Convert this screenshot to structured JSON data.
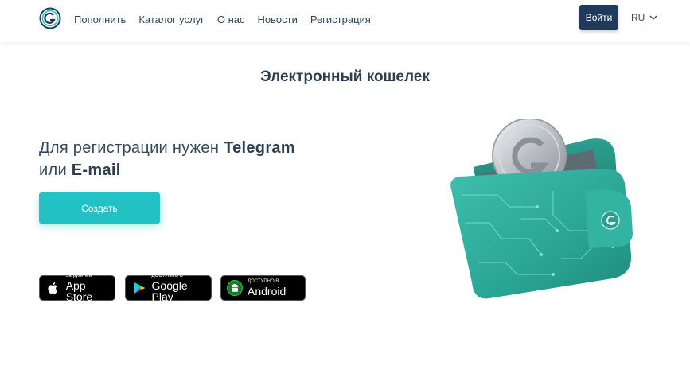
{
  "header": {
    "nav": [
      "Пополнить",
      "Каталог услуг",
      "О нас",
      "Новости",
      "Регистрация"
    ],
    "login_label": "Войти",
    "lang": "RU"
  },
  "main": {
    "title": "Электронный кошелек",
    "reg_prefix": "Для регистрации нужен ",
    "reg_telegram": "Telegram",
    "reg_or": "или ",
    "reg_email": "E-mail",
    "create_label": "Создать"
  },
  "stores": [
    {
      "small": "Загрузите в",
      "big": "App Store",
      "icon": "apple-icon"
    },
    {
      "small": "ДОСТУПНО В",
      "big": "Google Play",
      "icon": "google-play-icon"
    },
    {
      "small": "ДОСТУПНО В",
      "big": "Android",
      "icon": "android-icon"
    }
  ],
  "colors": {
    "accent": "#22c1c3",
    "navy": "#1f3a5a",
    "text": "#2c3e50"
  }
}
